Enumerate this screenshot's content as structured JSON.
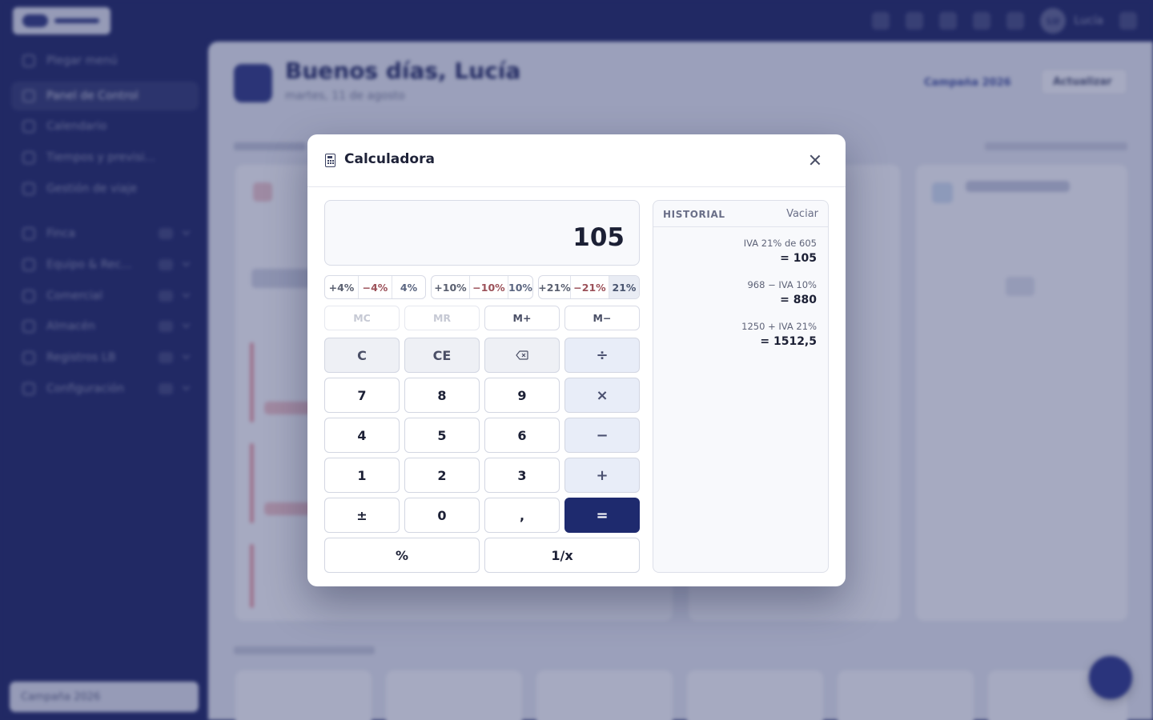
{
  "calculator": {
    "title": "Calculadora",
    "display": "105",
    "percent_groups": [
      {
        "plus": "+4%",
        "minus": "−4%",
        "base": "4%"
      },
      {
        "plus": "+10%",
        "minus": "−10%",
        "base": "10%"
      },
      {
        "plus": "+21%",
        "minus": "−21%",
        "base": "21%"
      }
    ],
    "selected_rate": "21%",
    "memory": {
      "mc": "MC",
      "mr": "MR",
      "mplus": "M+",
      "mminus": "M−"
    },
    "keys": {
      "clear": "C",
      "clear_entry": "CE",
      "divide": "÷",
      "seven": "7",
      "eight": "8",
      "nine": "9",
      "multiply": "×",
      "four": "4",
      "five": "5",
      "six": "6",
      "subtract": "−",
      "one": "1",
      "two": "2",
      "three": "3",
      "add": "+",
      "sign": "±",
      "zero": "0",
      "decimal": ",",
      "equals": "=",
      "percent": "%",
      "reciprocal": "1/x"
    },
    "icons": {
      "title": "calculator-icon",
      "close": "close-icon",
      "backspace": "backspace-icon"
    }
  },
  "history": {
    "title": "HISTORIAL",
    "clear_label": "Vaciar",
    "entries": [
      {
        "expression": "IVA 21% de 605",
        "result": "= 105"
      },
      {
        "expression": "968 − IVA 10%",
        "result": "= 880"
      },
      {
        "expression": "1250 + IVA 21%",
        "result": "= 1512,5"
      }
    ]
  },
  "background": {
    "user_name": "Lucía",
    "user_initials": "LU",
    "sidebar": {
      "items": [
        "Plegar menú",
        "Panel de Control",
        "Calendario",
        "Tiempos y previsi...",
        "Gestión de viaje",
        "Finca",
        "Equipo & Rec...",
        "Comercial",
        "Almacén",
        "Registros LB",
        "Configuración"
      ],
      "footer": "Campaña 2026"
    },
    "greeting": "Buenos días, Lucía",
    "date": "martes, 11 de agosto",
    "campaign": "Campaña 2026",
    "refresh": "Actualizar"
  }
}
